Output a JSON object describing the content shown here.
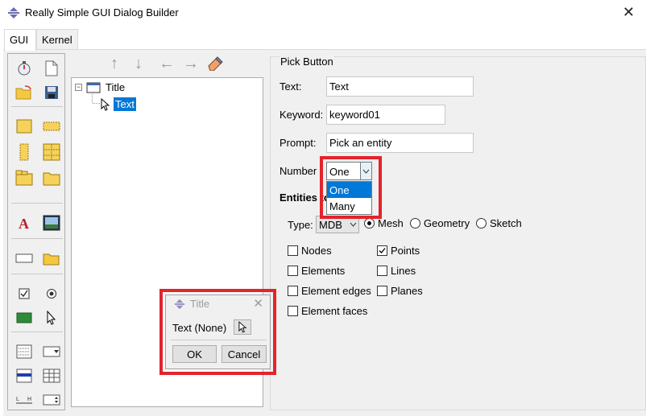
{
  "window": {
    "title": "Really Simple GUI Dialog Builder"
  },
  "tabs": [
    {
      "label": "GUI",
      "active": true
    },
    {
      "label": "Kernel",
      "active": false
    }
  ],
  "tree": {
    "root_label": "Title",
    "expander": "−",
    "child_label": "Text"
  },
  "panel": {
    "title": "Pick Button",
    "text_label": "Text:",
    "text_value": "Text",
    "keyword_label": "Keyword:",
    "keyword_value": "keyword01",
    "prompt_label": "Prompt:",
    "prompt_value": "Pick an entity",
    "number_label": "Number",
    "number_value": "One",
    "number_options": [
      "One",
      "Many"
    ],
    "entities_label": "Entities to",
    "type_label": "Type:",
    "type_value": "MDB",
    "radios": [
      {
        "label": "Mesh",
        "checked": true
      },
      {
        "label": "Geometry",
        "checked": false
      },
      {
        "label": "Sketch",
        "checked": false
      }
    ],
    "checkboxes": {
      "nodes": {
        "label": "Nodes",
        "checked": false
      },
      "elements": {
        "label": "Elements",
        "checked": false
      },
      "element_edges": {
        "label": "Element edges",
        "checked": false
      },
      "element_faces": {
        "label": "Element faces",
        "checked": false
      },
      "points": {
        "label": "Points",
        "checked": true
      },
      "lines": {
        "label": "Lines",
        "checked": false
      },
      "planes": {
        "label": "Planes",
        "checked": false
      }
    }
  },
  "preview": {
    "title": "Title",
    "label": "Text (None)",
    "ok": "OK",
    "cancel": "Cancel"
  },
  "colors": {
    "highlight": "#0078d7",
    "annotation": "#e3242b"
  }
}
